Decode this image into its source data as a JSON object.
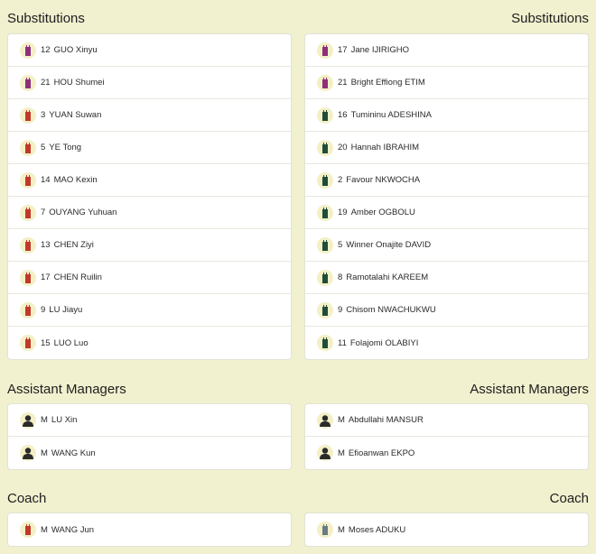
{
  "sections": {
    "substitutions": {
      "left_title": "Substitutions",
      "right_title": "Substitutions"
    },
    "assistant_managers": {
      "left_title": "Assistant Managers",
      "right_title": "Assistant Managers"
    },
    "coach": {
      "left_title": "Coach",
      "right_title": "Coach"
    }
  },
  "colors": {
    "home_jersey": "#c0392b",
    "away_jersey": "#1f4d3a",
    "goalkeeper_jersey": "#8e2f7c",
    "manager_silhouette": "#2b2b2b",
    "coach_away_jersey": "#6b7a86"
  },
  "home_subs": [
    {
      "number": "12",
      "name": "GUO Xinyu",
      "icon": "goalkeeper-jersey-icon"
    },
    {
      "number": "21",
      "name": "HOU Shumei",
      "icon": "goalkeeper-jersey-icon"
    },
    {
      "number": "3",
      "name": "YUAN Suwan",
      "icon": "jersey-icon"
    },
    {
      "number": "5",
      "name": "YE Tong",
      "icon": "jersey-icon"
    },
    {
      "number": "14",
      "name": "MAO Kexin",
      "icon": "jersey-icon"
    },
    {
      "number": "7",
      "name": "OUYANG Yuhuan",
      "icon": "jersey-icon"
    },
    {
      "number": "13",
      "name": "CHEN Ziyi",
      "icon": "jersey-icon"
    },
    {
      "number": "17",
      "name": "CHEN Ruilin",
      "icon": "jersey-icon"
    },
    {
      "number": "9",
      "name": "LU Jiayu",
      "icon": "jersey-icon"
    },
    {
      "number": "15",
      "name": "LUO Luo",
      "icon": "jersey-icon"
    }
  ],
  "away_subs": [
    {
      "number": "17",
      "name": "Jane IJIRIGHO",
      "icon": "goalkeeper-jersey-icon"
    },
    {
      "number": "21",
      "name": "Bright Effiong ETIM",
      "icon": "goalkeeper-jersey-icon"
    },
    {
      "number": "16",
      "name": "Tumininu ADESHINA",
      "icon": "jersey-icon"
    },
    {
      "number": "20",
      "name": "Hannah IBRAHIM",
      "icon": "jersey-icon"
    },
    {
      "number": "2",
      "name": "Favour NKWOCHA",
      "icon": "jersey-icon"
    },
    {
      "number": "19",
      "name": "Amber OGBOLU",
      "icon": "jersey-icon"
    },
    {
      "number": "5",
      "name": "Winner Onajite DAVID",
      "icon": "jersey-icon"
    },
    {
      "number": "8",
      "name": "Ramotalahi KAREEM",
      "icon": "jersey-icon"
    },
    {
      "number": "9",
      "name": "Chisom NWACHUKWU",
      "icon": "jersey-icon"
    },
    {
      "number": "11",
      "name": "Folajomi OLABIYI",
      "icon": "jersey-icon"
    }
  ],
  "home_assistants": [
    {
      "number": "M",
      "name": "LU Xin",
      "icon": "person-silhouette-icon"
    },
    {
      "number": "M",
      "name": "WANG Kun",
      "icon": "person-silhouette-icon"
    }
  ],
  "away_assistants": [
    {
      "number": "M",
      "name": "Abdullahi MANSUR",
      "icon": "person-silhouette-icon"
    },
    {
      "number": "M",
      "name": "Efioanwan EKPO",
      "icon": "person-silhouette-icon"
    }
  ],
  "home_coach": [
    {
      "number": "M",
      "name": "WANG Jun",
      "icon": "jersey-icon"
    }
  ],
  "away_coach": [
    {
      "number": "M",
      "name": "Moses ADUKU",
      "icon": "jersey-icon"
    }
  ]
}
